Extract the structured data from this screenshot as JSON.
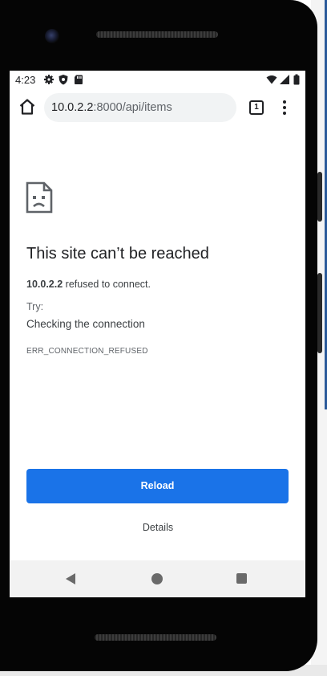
{
  "status_bar": {
    "time": "4:23",
    "left_icons": [
      "gear-icon",
      "shield-icon",
      "sd-card-icon"
    ],
    "right_icons": [
      "wifi-icon",
      "cell-signal-icon",
      "battery-icon"
    ]
  },
  "browser": {
    "url_host": "10.0.2.2",
    "url_rest": ":8000/api/items",
    "tab_count": "1"
  },
  "error_page": {
    "icon": "sad-page-icon",
    "title": "This site can’t be reached",
    "host": "10.0.2.2",
    "message": " refused to connect.",
    "try_label": "Try:",
    "suggestion": "Checking the connection",
    "error_code": "ERR_CONNECTION_REFUSED",
    "reload_label": "Reload",
    "details_label": "Details",
    "accent_color": "#1a73e8"
  },
  "nav_bar": [
    "back-icon",
    "home-circle-icon",
    "recents-square-icon"
  ]
}
